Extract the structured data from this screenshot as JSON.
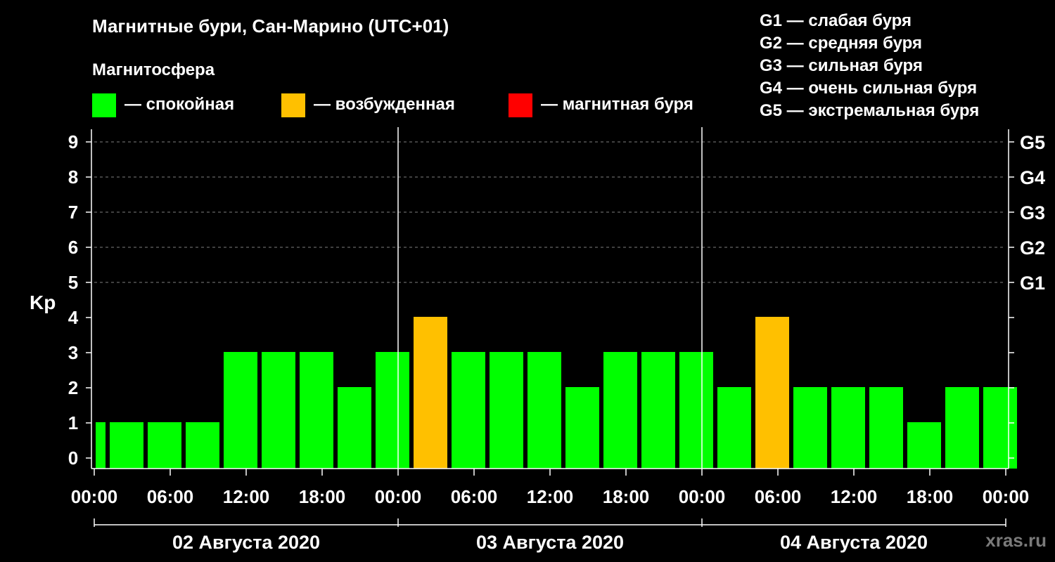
{
  "title": "Магнитные бури, Сан-Марино (UTC+01)",
  "subtitle": "Магнитосфера",
  "legend": [
    {
      "label": "— спокойная",
      "color": "#00ff00"
    },
    {
      "label": "— возбужденная",
      "color": "#ffc000"
    },
    {
      "label": "— магнитная буря",
      "color": "#ff0000"
    }
  ],
  "g_legend": [
    "G1 — слабая буря",
    "G2 — средняя буря",
    "G3 — сильная буря",
    "G4 — очень сильная буря",
    "G5 — экстремальная буря"
  ],
  "watermark": "xras.ru",
  "chart_data": {
    "type": "bar",
    "ylabel": "Kp",
    "ylim": [
      0,
      9
    ],
    "y_ticks": [
      "0",
      "1",
      "2",
      "3",
      "4",
      "5",
      "6",
      "7",
      "8",
      "9"
    ],
    "right_ticks": [
      {
        "kp": 5,
        "label": "G1"
      },
      {
        "kp": 6,
        "label": "G2"
      },
      {
        "kp": 7,
        "label": "G3"
      },
      {
        "kp": 8,
        "label": "G4"
      },
      {
        "kp": 9,
        "label": "G5"
      }
    ],
    "x_tick_labels": [
      "00:00",
      "06:00",
      "12:00",
      "18:00",
      "00:00",
      "06:00",
      "12:00",
      "18:00",
      "00:00",
      "06:00",
      "12:00",
      "18:00",
      "00:00"
    ],
    "days": [
      "02 Августа 2020",
      "03 Августа 2020",
      "04 Августа 2020"
    ],
    "interval_hours": 3,
    "values": [
      1,
      1,
      1,
      1,
      3,
      3,
      3,
      2,
      3,
      4,
      3,
      3,
      3,
      2,
      3,
      3,
      3,
      2,
      4,
      2,
      2,
      2,
      1,
      2,
      2
    ],
    "colors": {
      "quiet": "#00ff00",
      "active": "#ffc000",
      "storm": "#ff0000"
    },
    "grid": "dashed horizontal at Kp 5–9"
  }
}
